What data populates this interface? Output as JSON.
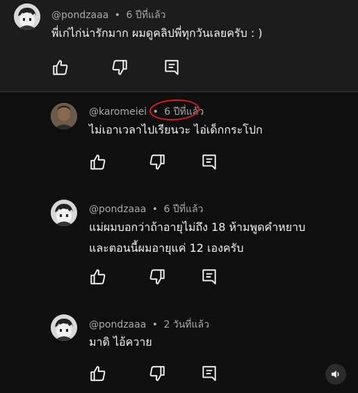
{
  "top_comment": {
    "handle": "@pondzaaa",
    "time": "6 ปีที่แล้ว",
    "lines": [
      "พี่เก่ไก่น่ารักมาก ผมดูคลิปพี่ทุกวันเลยครับ : )"
    ],
    "avatar_icon": "cartoon-avatar-icon"
  },
  "replies": [
    {
      "handle": "@karomeiei",
      "time": "6 ปีที่แล้ว",
      "lines": [
        "ไม่เอาเวลาไปเรียนวะ ไอ่เด็กกระโปก"
      ],
      "avatar_icon": "photo-avatar-icon"
    },
    {
      "handle": "@pondzaaa",
      "time": "6 ปีที่แล้ว",
      "lines": [
        "แม่ผมบอกว่าถ้าอายุไม่ถึง 18 ห้ามพูดคำหยาบ",
        "และตอนนี้ผมอายุแค่ 12 เองครับ"
      ],
      "avatar_icon": "cartoon-avatar-icon"
    },
    {
      "handle": "@pondzaaa",
      "time": "2 วันที่แล้ว",
      "lines": [
        "มาดิ ไอ้ควาย"
      ],
      "avatar_icon": "cartoon-avatar-icon"
    }
  ],
  "separator": "•",
  "colors": {
    "background": "#0f0f0f",
    "top_comment_bg": "#1c1c1c",
    "highlight_circle": "#d21f1f"
  },
  "icons": [
    "like-icon",
    "dislike-icon",
    "reply-icon",
    "volume-icon"
  ]
}
